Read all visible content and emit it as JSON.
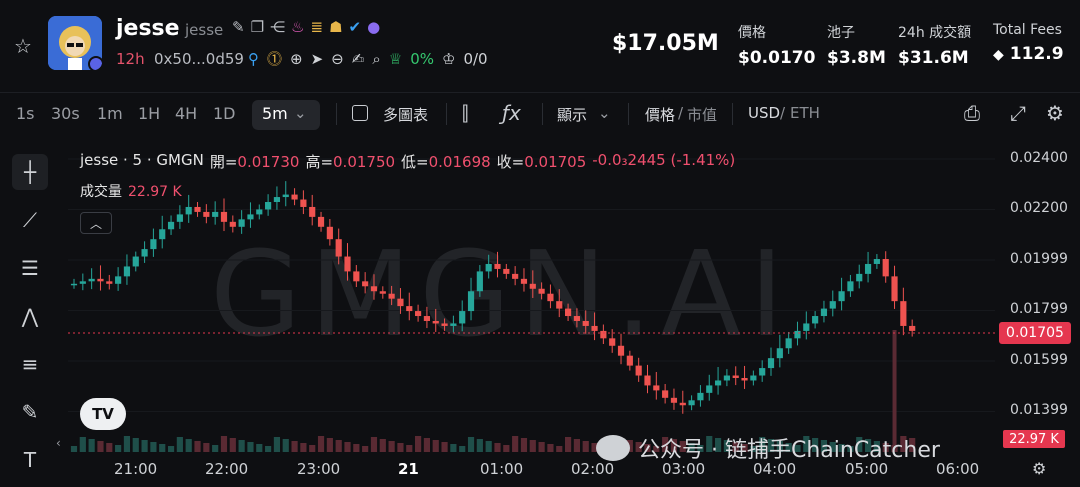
{
  "header": {
    "token_name": "jesse",
    "token_sub": "jesse",
    "age": "12h",
    "address": "0x50...0d59",
    "holders_pct": "0%",
    "holders_ratio": "0/0",
    "market_cap": "$17.05M",
    "stats": [
      {
        "label": "價格",
        "value": "$0.0170"
      },
      {
        "label": "池子",
        "value": "$3.8M"
      },
      {
        "label": "24h 成交額",
        "value": "$31.6M"
      },
      {
        "label": "Total Fees",
        "value": "112.9"
      }
    ]
  },
  "toolbar": {
    "timeframes": [
      "1s",
      "30s",
      "1m",
      "1H",
      "4H",
      "1D"
    ],
    "active_timeframe": "5m",
    "multi_chart_label": "多圖表",
    "display_label": "顯示",
    "price_label": "價格",
    "mcap_label": "市值",
    "usd_label": "USD",
    "eth_label": "ETH"
  },
  "legend": {
    "symbol": "jesse · 5 · GMGN",
    "open_label": "開=",
    "open": "0.01730",
    "high_label": "高=",
    "high": "0.01750",
    "low_label": "低=",
    "low": "0.01698",
    "close_label": "收=",
    "close": "0.01705",
    "change": "-0.0₃2445 (-1.41%)",
    "volume_label": "成交量",
    "volume": "22.97 K"
  },
  "watermark": "GMGN.AI",
  "wechat_watermark": "公众号 · 链捕手ChainCatcher",
  "current_price_tag": "0.01705",
  "volume_tag": "22.97 K",
  "colors": {
    "up": "#26a69a",
    "down": "#ef5350",
    "accent_red": "#e5374f",
    "green": "#35c76f"
  },
  "chart_data": {
    "type": "candlestick",
    "y_axis_ticks": [
      "0.02400",
      "0.02200",
      "0.01999",
      "0.01799",
      "0.01599",
      "0.01399"
    ],
    "x_axis_ticks": [
      "21:00",
      "22:00",
      "23:00",
      "21",
      "01:00",
      "02:00",
      "03:00",
      "04:00",
      "05:00",
      "06:00"
    ],
    "ylim": [
      0.0128,
      0.0245
    ],
    "current_price": 0.01705,
    "close_path": [
      0.0189,
      0.019,
      0.0191,
      0.019,
      0.0189,
      0.0192,
      0.0196,
      0.02,
      0.0203,
      0.0207,
      0.0211,
      0.0214,
      0.0217,
      0.022,
      0.0218,
      0.0216,
      0.0218,
      0.0214,
      0.0212,
      0.0215,
      0.0217,
      0.0219,
      0.0222,
      0.0224,
      0.0225,
      0.0223,
      0.022,
      0.0216,
      0.0212,
      0.0207,
      0.02,
      0.0194,
      0.019,
      0.0188,
      0.0186,
      0.0185,
      0.0183,
      0.018,
      0.0178,
      0.0176,
      0.0174,
      0.0173,
      0.0172,
      0.0173,
      0.0178,
      0.0186,
      0.0194,
      0.0197,
      0.0195,
      0.0193,
      0.0191,
      0.0189,
      0.0187,
      0.0185,
      0.0182,
      0.0179,
      0.0176,
      0.0174,
      0.0172,
      0.017,
      0.0167,
      0.0164,
      0.016,
      0.0156,
      0.0152,
      0.0148,
      0.0146,
      0.0143,
      0.0141,
      0.014,
      0.0142,
      0.0145,
      0.0148,
      0.015,
      0.0152,
      0.0151,
      0.015,
      0.0152,
      0.0155,
      0.0159,
      0.0163,
      0.0167,
      0.017,
      0.0173,
      0.0176,
      0.0179,
      0.0182,
      0.0186,
      0.019,
      0.0193,
      0.0197,
      0.0199,
      0.0192,
      0.0182,
      0.0172,
      0.017
    ]
  }
}
